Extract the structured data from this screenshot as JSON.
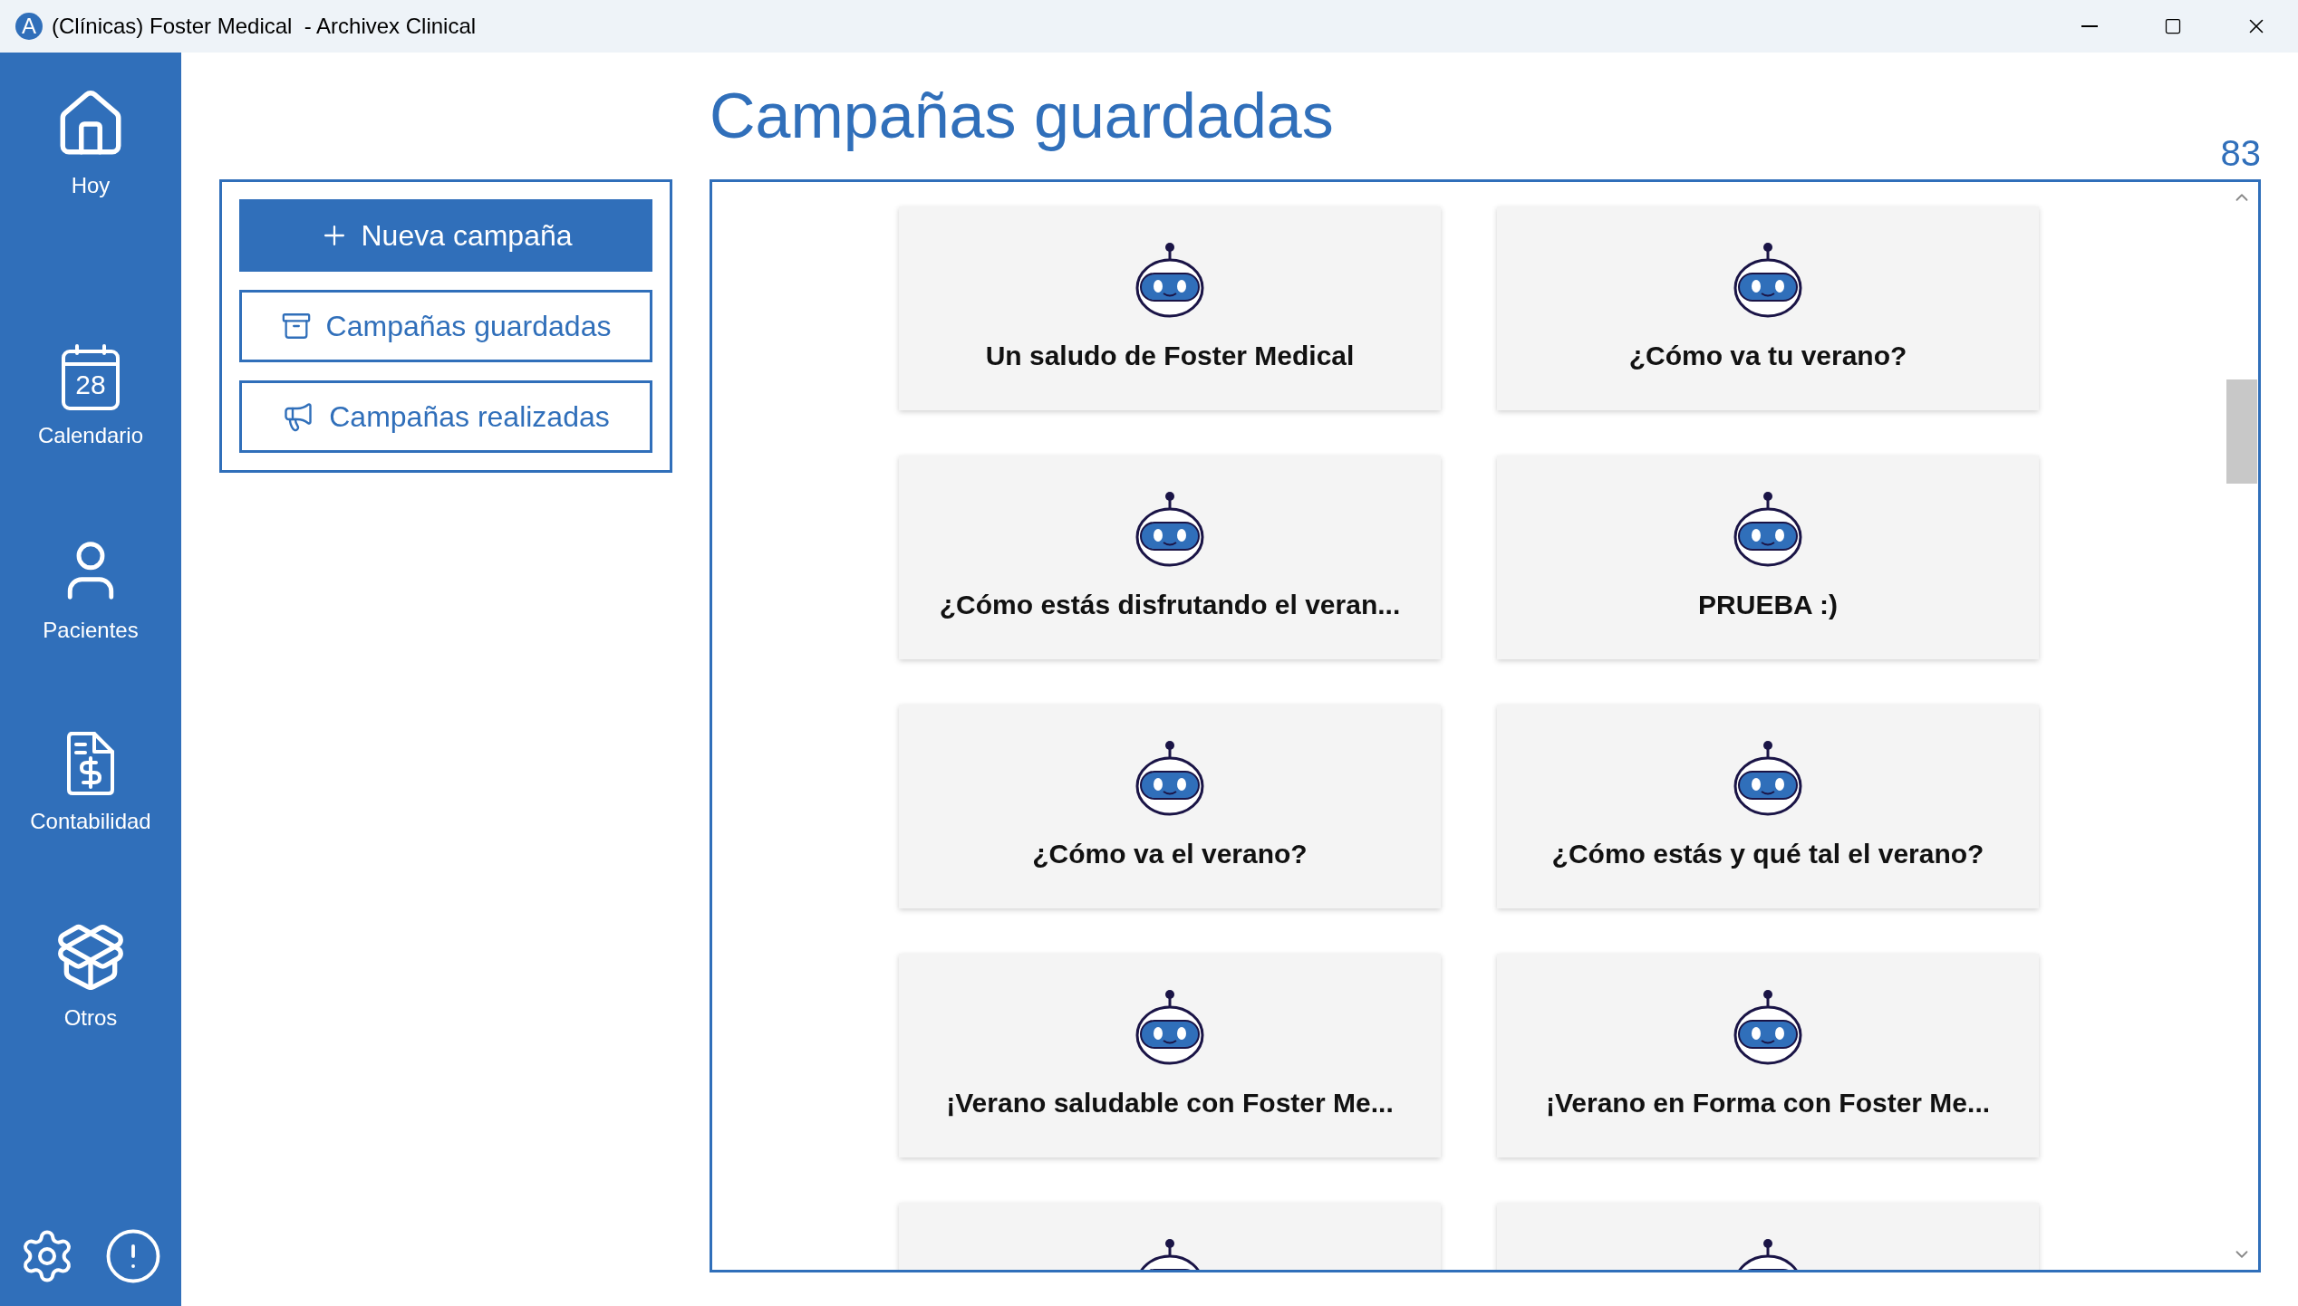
{
  "window": {
    "logo": "A",
    "title": "(Clínicas) Foster Medical  - Archivex Clinical"
  },
  "sidebar": {
    "items": [
      {
        "kind": "home",
        "label": "Hoy"
      },
      {
        "kind": "calendar",
        "label": "Calendario",
        "day": "28"
      },
      {
        "kind": "patients",
        "label": "Pacientes"
      },
      {
        "kind": "accounting",
        "label": "Contabilidad"
      },
      {
        "kind": "other",
        "label": "Otros"
      }
    ]
  },
  "actions": [
    {
      "kind": "new",
      "label": "Nueva campaña"
    },
    {
      "kind": "saved",
      "label": "Campañas guardadas"
    },
    {
      "kind": "done",
      "label": "Campañas realizadas"
    }
  ],
  "page": {
    "title": "Campañas guardadas",
    "count": "83"
  },
  "campaigns": [
    {
      "title": "Un saludo de Foster Medical"
    },
    {
      "title": "¿Cómo va tu verano?"
    },
    {
      "title": "¿Cómo estás disfrutando el veran..."
    },
    {
      "title": "PRUEBA :)"
    },
    {
      "title": "¿Cómo va el verano?"
    },
    {
      "title": "¿Cómo estás y qué tal el verano?"
    },
    {
      "title": "¡Verano saludable con Foster Me..."
    },
    {
      "title": "¡Verano en Forma con Foster Me..."
    }
  ]
}
